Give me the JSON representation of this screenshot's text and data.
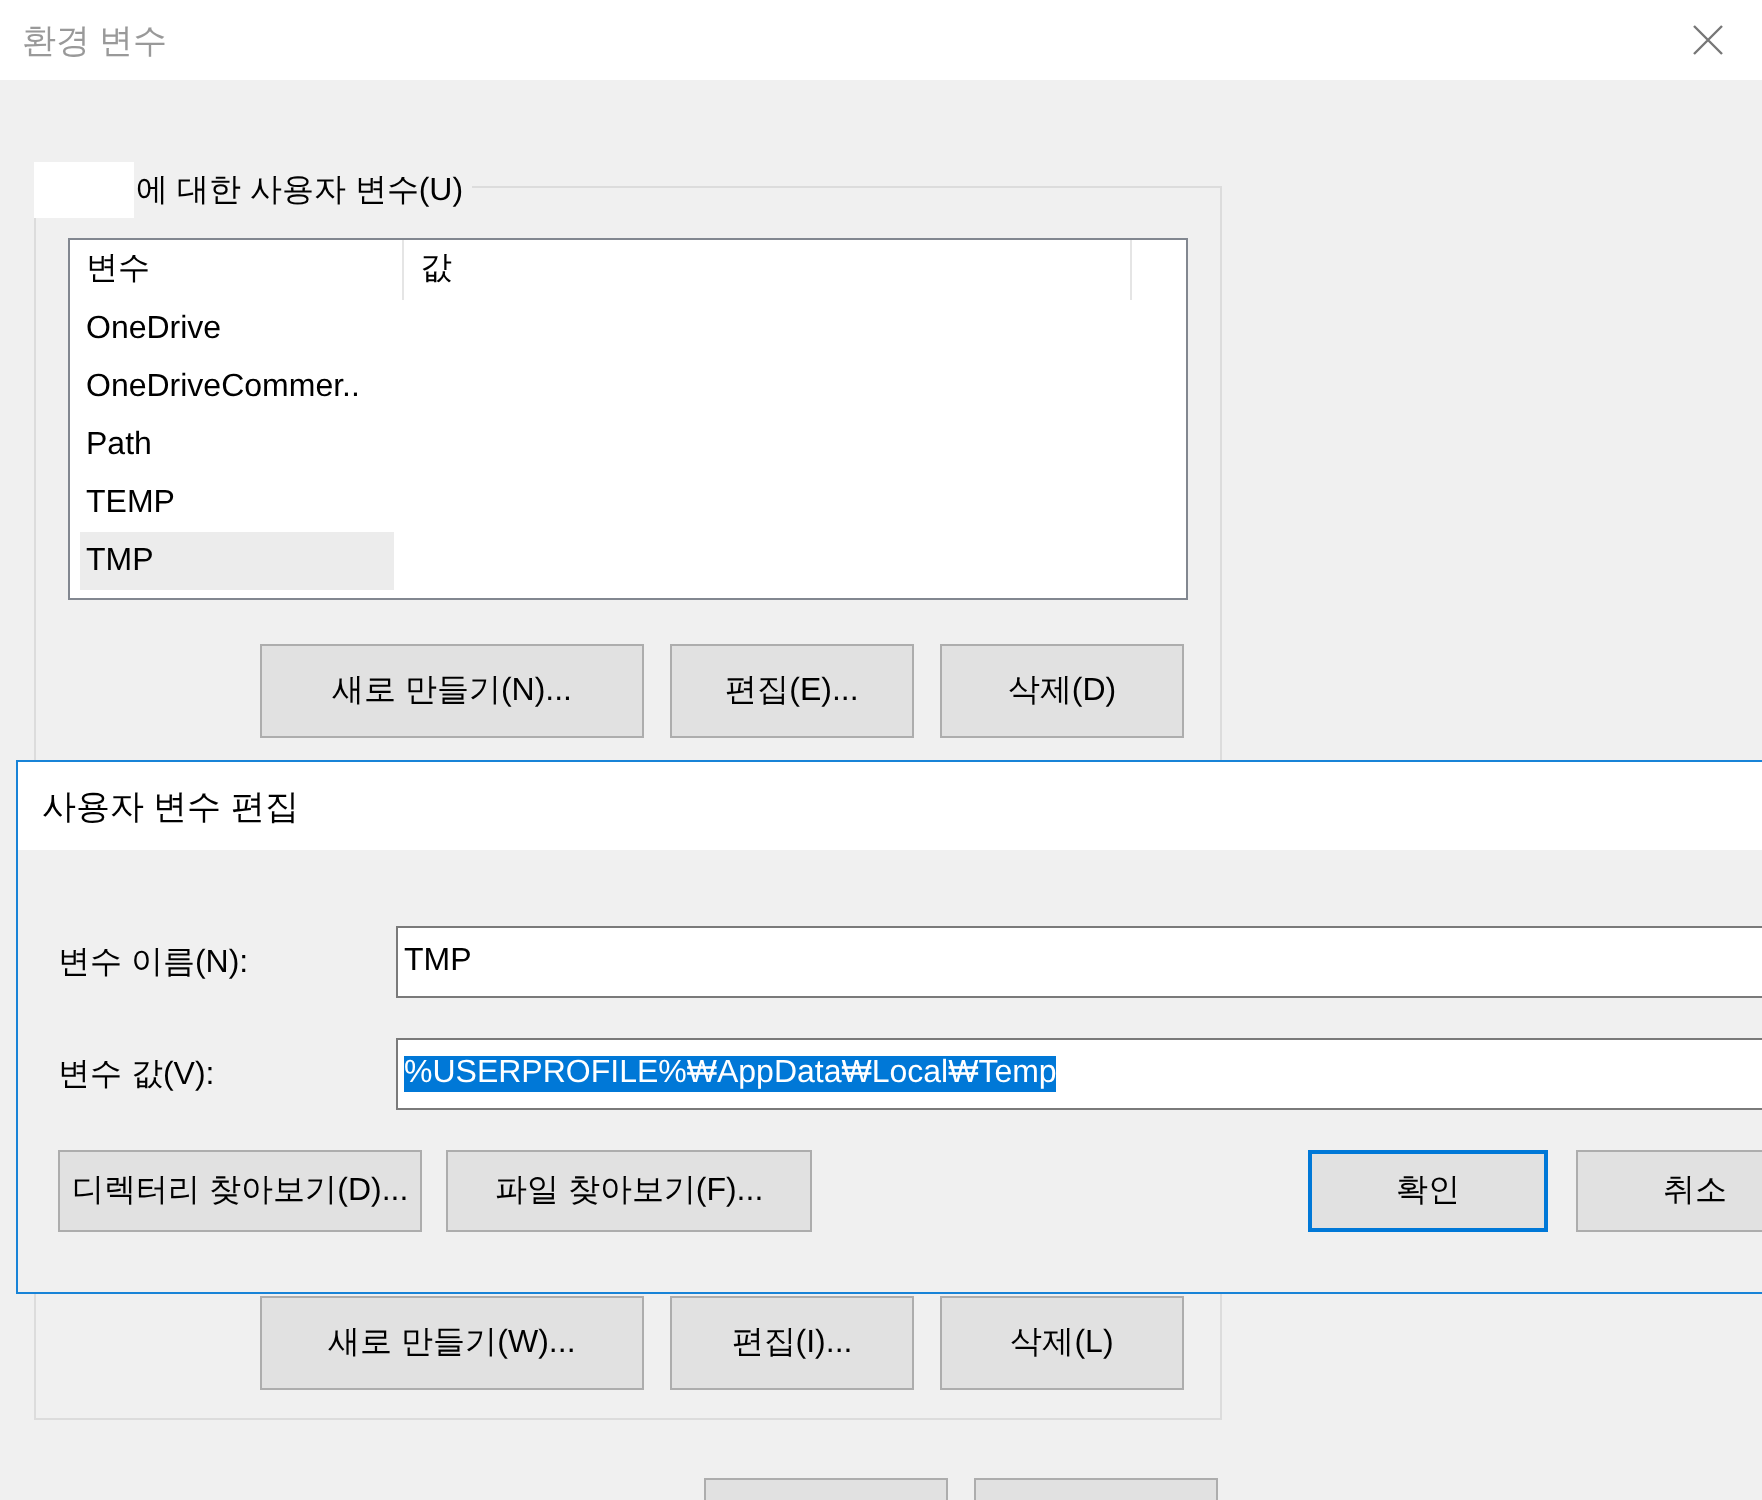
{
  "window": {
    "title": "환경 변수"
  },
  "user_variables": {
    "label": "에 대한 사용자 변수(U)",
    "columns": [
      "변수",
      "값"
    ],
    "rows": [
      {
        "name": "OneDrive",
        "selected": false
      },
      {
        "name": "OneDriveCommer..",
        "selected": false
      },
      {
        "name": "Path",
        "selected": false
      },
      {
        "name": "TEMP",
        "selected": false
      },
      {
        "name": "TMP",
        "selected": true
      }
    ],
    "buttons": [
      "새로 만들기(N)...",
      "편집(E)...",
      "삭제(D)"
    ]
  },
  "system_variables": {
    "buttons": [
      "새로 만들기(W)...",
      "편집(I)...",
      "삭제(L)"
    ]
  },
  "edit_dialog": {
    "title": "사용자 변수 편집",
    "fields": [
      {
        "label": "변수 이름(N):",
        "value": "TMP",
        "text_selected": false
      },
      {
        "label": "변수 값(V):",
        "value": "%USERPROFILE%₩AppData₩Local₩Temp",
        "text_selected": true
      }
    ],
    "browse_buttons": [
      "디렉터리 찾아보기(D)...",
      "파일 찾아보기(F)..."
    ],
    "buttons": [
      {
        "label": "확인",
        "default": true
      },
      {
        "label": "취소",
        "default": false
      }
    ]
  }
}
